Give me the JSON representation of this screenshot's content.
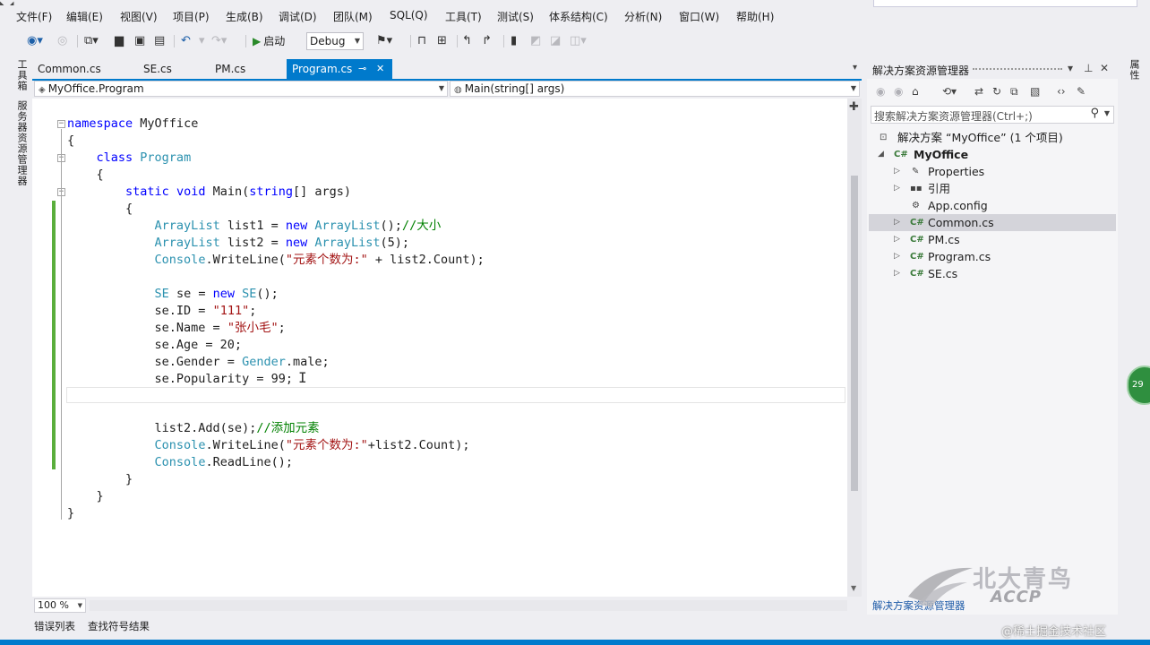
{
  "menu": [
    "文件(F)",
    "编辑(E)",
    "视图(V)",
    "项目(P)",
    "生成(B)",
    "调试(D)",
    "团队(M)",
    "SQL(Q)",
    "工具(T)",
    "测试(S)",
    "体系结构(C)",
    "分析(N)",
    "窗口(W)",
    "帮助(H)"
  ],
  "toolbar": {
    "start_label": "启动",
    "config_value": "Debug"
  },
  "left_strip": {
    "toolbox_label": "工具箱",
    "server_explorer_label": "服务器资源管理器"
  },
  "tabs": [
    {
      "label": "Common.cs",
      "active": false
    },
    {
      "label": "SE.cs",
      "active": false
    },
    {
      "label": "PM.cs",
      "active": false
    },
    {
      "label": "Program.cs",
      "active": true
    }
  ],
  "navbar": {
    "class_value": "MyOffice.Program",
    "member_value": "Main(string[] args)"
  },
  "code": [
    "namespace MyOffice",
    "{",
    "    class Program",
    "    {",
    "        static void Main(string[] args)",
    "        {",
    "            ArrayList list1 = new ArrayList();//大小",
    "            ArrayList list2 = new ArrayList(5);",
    "            Console.WriteLine(\"元素个数为:\" + list2.Count);",
    "",
    "            SE se = new SE();",
    "            se.ID = \"111\";",
    "            se.Name = \"张小毛\";",
    "            se.Age = 20;",
    "            se.Gender = Gender.male;",
    "            se.Popularity = 99;",
    "",
    "",
    "            list2.Add(se);//添加元素",
    "            Console.WriteLine(\"元素个数为:\"+list2.Count);",
    "            Console.ReadLine();",
    "        }",
    "    }",
    "}"
  ],
  "editor": {
    "zoom": "100 %"
  },
  "bottom_tabs": [
    "错误列表",
    "查找符号结果"
  ],
  "solution_explorer": {
    "title": "解决方案资源管理器",
    "search_placeholder": "搜索解决方案资源管理器(Ctrl+;)",
    "tree": [
      {
        "label": "解决方案 “MyOffice” (1 个项目)",
        "icon": "solution-icon"
      },
      {
        "label": "MyOffice",
        "icon": "csharp-project-icon"
      },
      {
        "label": "Properties",
        "icon": "wrench-icon"
      },
      {
        "label": "引用",
        "icon": "references-icon"
      },
      {
        "label": "App.config",
        "icon": "config-file-icon"
      },
      {
        "label": "Common.cs",
        "icon": "csharp-file-icon",
        "selected": true
      },
      {
        "label": "PM.cs",
        "icon": "csharp-file-icon"
      },
      {
        "label": "Program.cs",
        "icon": "csharp-file-icon"
      },
      {
        "label": "SE.cs",
        "icon": "csharp-file-icon"
      }
    ],
    "bottom_tab": "解决方案资源管理器"
  },
  "right_strip": {
    "label": "属性"
  },
  "badge": "29",
  "watermark": {
    "logo_text": "北大青鸟",
    "logo_sub": "ACCP",
    "corner": "@稀土掘金技术社区"
  },
  "colors": {
    "accent": "#007acc",
    "keyword": "#0000ff",
    "type": "#2b91af",
    "string": "#a31515",
    "comment": "#008000",
    "change_bar": "#5aae3c"
  }
}
